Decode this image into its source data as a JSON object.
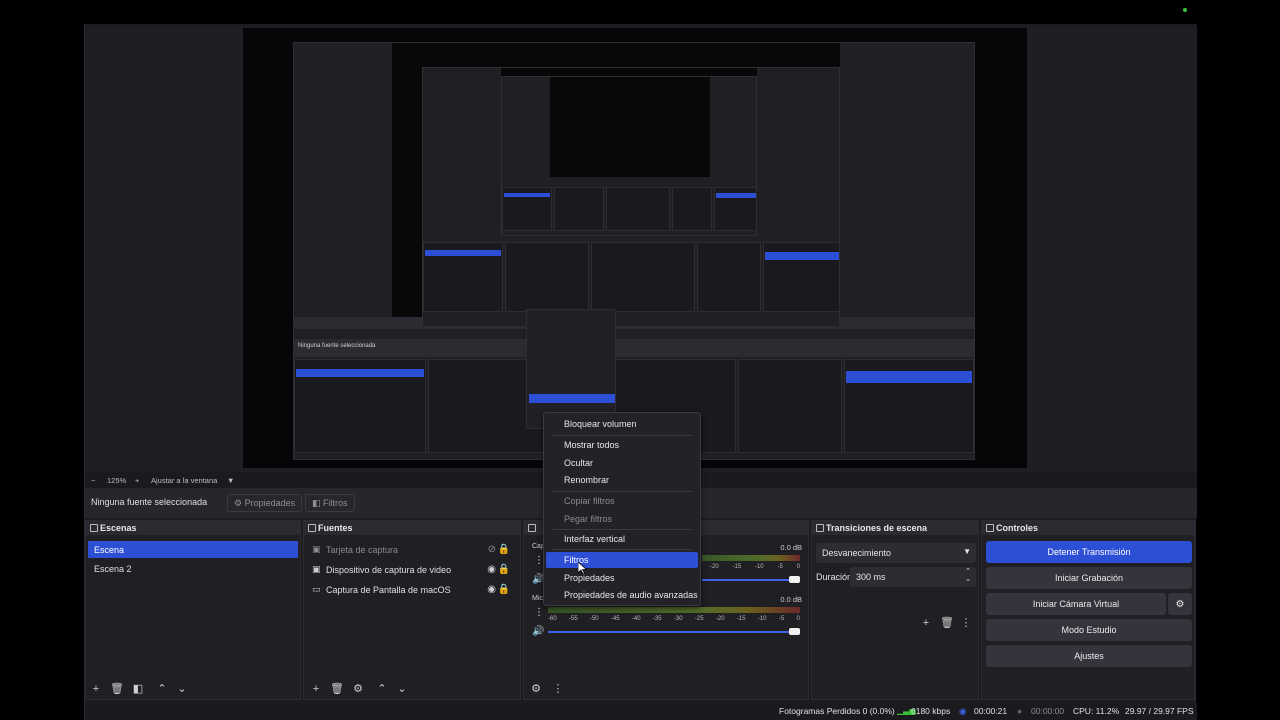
{
  "zoom": {
    "level": "125%",
    "fit_label": "Ajustar a la ventana"
  },
  "infobar": {
    "no_selection": "Ninguna fuente seleccionada",
    "properties": "Propiedades",
    "filters": "Filtros"
  },
  "scenes": {
    "title": "Escenas",
    "items": [
      "Escena",
      "Escena 2"
    ]
  },
  "sources": {
    "title": "Fuentes",
    "items": [
      "Tarjeta de captura",
      "Dispositivo de captura de video",
      "Captura de Pantalla de macOS"
    ]
  },
  "mixer": {
    "strip1": {
      "label": "Cap",
      "db": "0.0 dB"
    },
    "strip2": {
      "label": "Mic",
      "db": "0.0 dB"
    },
    "ticks": [
      "-20",
      "-15",
      "-10",
      "-5",
      "0"
    ],
    "ticks_long": [
      "-60",
      "-55",
      "-50",
      "-45",
      "-40",
      "-35",
      "-30",
      "-25",
      "-20",
      "-15",
      "-10",
      "-5",
      "0"
    ]
  },
  "transitions": {
    "title": "Transiciones de escena",
    "type": "Desvanecimiento",
    "duration_label": "Duración",
    "duration_value": "300 ms"
  },
  "controls": {
    "title": "Controles",
    "stop_stream": "Detener Transmisión",
    "start_recording": "Iniciar Grabación",
    "start_virtual_camera": "Iniciar Cámara Virtual",
    "studio_mode": "Modo Estudio",
    "settings": "Ajustes"
  },
  "context_menu": {
    "lock_volume": "Bloquear volumen",
    "show_all": "Mostrar todos",
    "hide": "Ocultar",
    "rename": "Renombrar",
    "copy_filters": "Copiar filtros",
    "paste_filters": "Pegar filtros",
    "vertical_layout": "Interfaz vertical",
    "filters": "Filtros",
    "properties": "Propiedades",
    "advanced_audio": "Propiedades de audio avanzadas"
  },
  "status": {
    "dropped_frames": "Fotogramas Perdidos 0 (0.0%)",
    "bitrate": "6180 kbps",
    "stream_time": "00:00:21",
    "record_time": "00:00:00",
    "cpu": "CPU: 11.2%",
    "fps": "29.97 / 29.97 FPS"
  },
  "colors": {
    "accent": "#2d4fd6",
    "background": "#1c1c20",
    "panel": "#1f1f24",
    "status_green": "#3ac13a"
  }
}
